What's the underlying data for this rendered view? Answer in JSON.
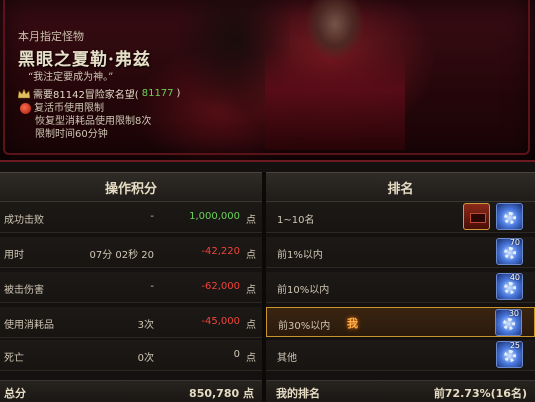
{
  "banner": {
    "month_label": "本月指定怪物",
    "boss_name": "黑眼之夏勒·弗兹",
    "quote": "“我注定要成为神。”",
    "requirement_prefix": "需要81142冒险家名望(",
    "requirement_value": "81177",
    "requirement_suffix": ")",
    "restrictions": [
      "复活币使用限制",
      "恢复型消耗品使用限制8次",
      "限制时间60分钟"
    ]
  },
  "score_panel": {
    "header": "操作积分",
    "rows": [
      {
        "label": "成功击败",
        "detail": "-",
        "points": "1,000,000",
        "points_color": "green",
        "unit": "点"
      },
      {
        "label": "用时",
        "detail": "07分 02秒 20",
        "points": "-42,220",
        "points_color": "red",
        "unit": "点"
      },
      {
        "label": "被击伤害",
        "detail": "-",
        "points": "-62,000",
        "points_color": "red",
        "unit": "点"
      },
      {
        "label": "使用消耗品",
        "detail": "3次",
        "points": "-45,000",
        "points_color": "red",
        "unit": "点"
      },
      {
        "label": "死亡",
        "detail": "0次",
        "points": "0",
        "points_color": "normal",
        "unit": "点"
      }
    ],
    "total_label": "总分",
    "total_value": "850,780",
    "total_unit": "点"
  },
  "rank_panel": {
    "header": "排名",
    "rows": [
      {
        "label": "1~10名",
        "reward_count": "",
        "is_me": false
      },
      {
        "label": "前1%以内",
        "reward_count": "70",
        "is_me": false
      },
      {
        "label": "前10%以内",
        "reward_count": "40",
        "is_me": false
      },
      {
        "label": "前30%以内",
        "reward_count": "30",
        "is_me": true
      },
      {
        "label": "其他",
        "reward_count": "25",
        "is_me": false
      }
    ],
    "me_tag": "我",
    "my_rank_label": "我的排名",
    "my_rank_value": "前72.73%(16名)"
  },
  "colors": {
    "green": "#6ad35a",
    "red": "#f0433a",
    "gold_border": "#c8962c"
  }
}
